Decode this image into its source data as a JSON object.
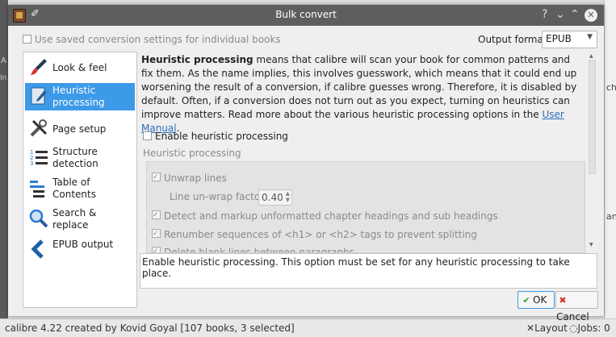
{
  "background": {
    "right_texts": [
      "ch",
      "an"
    ],
    "left_labels": [
      "A",
      "In"
    ],
    "status": {
      "left": "calibre 4.22 created by Kovid Goyal   [107 books, 3 selected]",
      "layout": "Layout",
      "jobs": "Jobs: 0"
    }
  },
  "dialog": {
    "title": "Bulk convert",
    "titlebar_buttons": {
      "help": "?",
      "minimize": "⌄",
      "maximize": "⌃",
      "close": "✕"
    },
    "use_saved_label": "Use saved conversion settings for individual books",
    "output_format_label": "Output format:",
    "output_format_value": "EPUB",
    "sidebar": {
      "items": [
        {
          "label_1": "Look & feel",
          "label_2": "",
          "icon": "paintbrush-icon"
        },
        {
          "label_1": "Heuristic",
          "label_2": "processing",
          "icon": "document-pen-icon",
          "selected": true
        },
        {
          "label_1": "Page setup",
          "label_2": "",
          "icon": "tools-icon"
        },
        {
          "label_1": "Structure",
          "label_2": "detection",
          "icon": "numbered-list-icon"
        },
        {
          "label_1": "Table of",
          "label_2": "Contents",
          "icon": "toc-icon"
        },
        {
          "label_1": "Search &",
          "label_2": "replace",
          "icon": "magnifier-icon"
        },
        {
          "label_1": "EPUB output",
          "label_2": "",
          "icon": "chevron-left-icon"
        }
      ]
    },
    "intro": {
      "bold": "Heuristic processing",
      "text": " means that calibre will scan your book for common patterns and fix them. As the name implies, this involves guesswork, which means that it could end up worsening the result of a conversion, if calibre guesses wrong. Therefore, it is disabled by default. Often, if a conversion does not turn out as you expect, turning on heuristics can improve matters. Read more about the various heuristic processing options in the ",
      "link": "User Manual",
      "end": "."
    },
    "enable_heuristic_label": "Enable heuristic processing",
    "heuristic_group_title": "Heuristic processing",
    "options": {
      "unwrap_lines": "Unwrap lines",
      "unwrap_factor_label": "Line un-wrap factor:",
      "unwrap_factor_value": "0.40",
      "detect_headings": "Detect and markup unformatted chapter headings and sub headings",
      "renumber": "Renumber sequences of <h1> or <h2> tags to prevent splitting",
      "delete_blank": "Delete blank lines between paragraphs"
    },
    "help_text": "Enable heuristic processing. This option must be set for any heuristic processing to take place.",
    "ok_label": "OK",
    "cancel_label": "Cancel"
  }
}
